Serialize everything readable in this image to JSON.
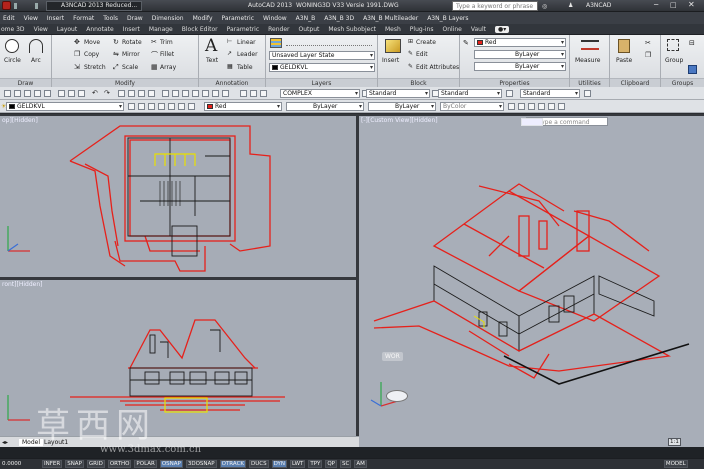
{
  "window": {
    "app_button": "A3NCAD 2013 Reduced...",
    "app_title": "AutoCAD 2013",
    "file_title": "WONING3D V33 Versie 1991.DWG",
    "search_placeholder": "Type a keyword or phrase",
    "user": "A3NCAD"
  },
  "menu": [
    "Edit",
    "View",
    "Insert",
    "Format",
    "Tools",
    "Draw",
    "Dimension",
    "Modify",
    "Parametric",
    "Window",
    "A3N_B",
    "A3N_B 3D",
    "A3N_B Multileader",
    "A3N_B Layers"
  ],
  "tabs": [
    "ome 3D",
    "View",
    "Layout",
    "Annotate",
    "Insert",
    "Manage",
    "Block Editor",
    "Parametric",
    "Render",
    "Output",
    "Mesh Subobject",
    "Mesh",
    "Plug-ins",
    "Online",
    "Vault"
  ],
  "ribbon": {
    "draw": {
      "circle": "Circle",
      "arc": "Arc",
      "label": "Draw"
    },
    "modify": {
      "move": "Move",
      "copy": "Copy",
      "stretch": "Stretch",
      "rotate": "Rotate",
      "mirror": "Mirror",
      "scale": "Scale",
      "trim": "Trim",
      "fillet": "Fillet",
      "array": "Array",
      "label": "Modify"
    },
    "annotation": {
      "text": "Text",
      "linear": "Linear",
      "leader": "Leader",
      "table": "Table",
      "label": "Annotation"
    },
    "layers": {
      "state": "Unsaved Layer State",
      "current": "GELDKVL",
      "label": "Layers"
    },
    "block": {
      "insert": "Insert",
      "create": "Create",
      "edit": "Edit",
      "edit_attr": "Edit Attributes",
      "label": "Block"
    },
    "properties": {
      "color": "Red",
      "linetype": "ByLayer",
      "lineweight": "ByLayer",
      "label": "Properties"
    },
    "utilities": {
      "measure": "Measure",
      "label": "Utilities"
    },
    "clipboard": {
      "paste": "Paste",
      "label": "Clipboard"
    },
    "groups": {
      "group": "Group",
      "label": "Groups"
    }
  },
  "toolbar1": {
    "linetype": "COMPLEX",
    "textstyle": "Standard",
    "dimstyle": "Standard",
    "tablestyle": "Standard"
  },
  "toolbar2": {
    "layer": "GELDKVL",
    "color": "Red",
    "linetype": "ByLayer",
    "lineweight": "ByLayer",
    "plotstyle": "ByColor"
  },
  "colors": {
    "red": "#e6211b",
    "yellow": "#e8e000"
  },
  "viewports": {
    "plan": "op][Hidden]",
    "elevation": "ront][Hidden]",
    "iso": "[-][Custom View][Hidden]",
    "iso_badge": "WOR"
  },
  "layout_tabs": [
    "Model",
    "Layout1"
  ],
  "command_prompt": "",
  "status": {
    "coords": "0.0000",
    "items": [
      "INFER",
      "SNAP",
      "GRID",
      "ORTHO",
      "POLAR",
      "OSNAP",
      "3DOSNAP",
      "OTRACK",
      "DUCS",
      "DYN",
      "LWT",
      "TPY",
      "QP",
      "SC",
      "AM"
    ],
    "model": "MODEL",
    "scale": "1:1"
  },
  "watermark": {
    "cn": "草西网",
    "url": "www.3dmax.com.cn"
  }
}
